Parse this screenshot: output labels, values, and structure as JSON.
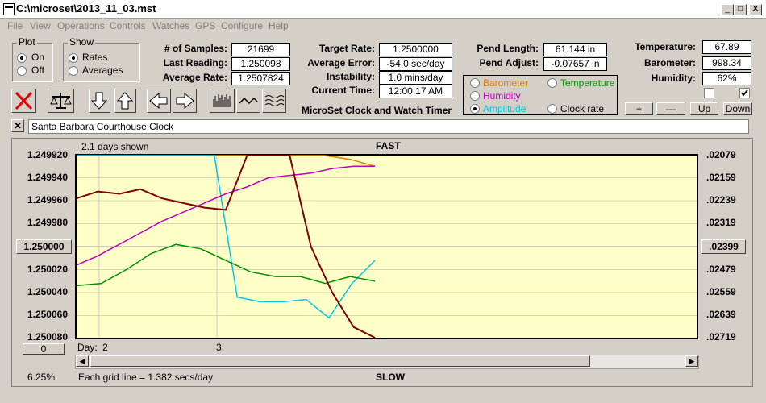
{
  "window": {
    "title": "C:\\microset\\2013_11_03.mst",
    "min": "_",
    "max": "□",
    "close": "X"
  },
  "menu": [
    "File",
    "View",
    "Operations",
    "Controls",
    "Watches",
    "GPS",
    "Configure",
    "Help"
  ],
  "plot": {
    "label": "Plot",
    "options": [
      "On",
      "Off"
    ],
    "selected": "On"
  },
  "show": {
    "label": "Show",
    "options": [
      "Rates",
      "Averages"
    ],
    "selected": "Rates"
  },
  "stats": {
    "samples_label": "# of Samples:",
    "samples": "21699",
    "last_label": "Last Reading:",
    "last": "1.250098",
    "avg_label": "Average Rate:",
    "avg": "1.2507824",
    "target_label": "Target Rate:",
    "target": "1.2500000",
    "error_label": "Average Error:",
    "error": "-54.0 sec/day",
    "instab_label": "Instability:",
    "instab": "1.0 mins/day",
    "time_label": "Current Time:",
    "time": "12:00:17 AM",
    "app_name": "MicroSet Clock and Watch Timer",
    "pend_len_label": "Pend Length:",
    "pend_len": "61.144 in",
    "pend_adj_label": "Pend Adjust:",
    "pend_adj": "-0.07657 in",
    "temp_label": "Temperature:",
    "temp": "67.89",
    "baro_label": "Barometer:",
    "baro": "998.34",
    "hum_label": "Humidity:",
    "hum": "62%"
  },
  "sensor_options": [
    {
      "label": "Barometer",
      "color": "#e08000"
    },
    {
      "label": "Temperature",
      "color": "#009000"
    },
    {
      "label": "Humidity",
      "color": "#c000c0"
    },
    {
      "label": "Amplitude",
      "color": "#00c8e0"
    },
    {
      "label": "Clock rate",
      "color": "#000000"
    }
  ],
  "sensor_selected": "Amplitude",
  "adjust_buttons": {
    "plus": "+",
    "minus": "—",
    "up": "Up",
    "down": "Down"
  },
  "clock_name": "Santa Barbara Courthouse Clock",
  "chart": {
    "days_shown": "2.1 days shown",
    "top": "FAST",
    "bottom": "SLOW",
    "grid_note": "Each grid line = 1.382 secs/day",
    "percent": "6.25%",
    "center_left": "1.250000",
    "center_right": ".02399",
    "zero_button": "0",
    "day_label": "Day:",
    "day_ticks": [
      "2",
      "3"
    ]
  },
  "chart_data": {
    "type": "line",
    "left_axis": [
      "1.249920",
      "1.249940",
      "1.249960",
      "1.249980",
      "1.250000",
      "1.250020",
      "1.250040",
      "1.250060",
      "1.250080"
    ],
    "right_axis": [
      ".02079",
      ".02159",
      ".02239",
      ".02319",
      ".02399",
      ".02479",
      ".02559",
      ".02639",
      ".02719"
    ],
    "series": [
      {
        "color": "#e08000",
        "values": [
          -6.5,
          -6.3,
          -6.0,
          -5.5,
          -5.2,
          -4.8,
          -4.9,
          -4.7,
          -4.8,
          -4.5,
          -4.3,
          -3.8,
          -3.5
        ]
      },
      {
        "color": "#00c8e0",
        "values": [
          -5.0,
          -5.0,
          -4.9,
          -4.8,
          -4.8,
          -4.7,
          -4.6,
          2.2,
          2.4,
          2.4,
          2.3,
          3.1,
          1.6,
          0.6
        ]
      },
      {
        "color": "#c000c0",
        "values": [
          0.8,
          0.4,
          -0.1,
          -0.6,
          -1.1,
          -1.5,
          -1.9,
          -2.3,
          -2.6,
          -3.0,
          -3.1,
          -3.2,
          -3.4,
          -3.5,
          -3.5
        ]
      },
      {
        "color": "#009000",
        "values": [
          1.7,
          1.6,
          1.0,
          0.3,
          -0.1,
          0.1,
          0.6,
          1.1,
          1.3,
          1.3,
          1.6,
          1.3,
          1.5
        ]
      },
      {
        "color": "#800000",
        "values": [
          -2.1,
          -2.4,
          -2.3,
          -2.5,
          -2.1,
          -1.9,
          -1.7,
          -1.6,
          -6.0,
          -11.0,
          -15.0,
          0.0,
          2.0,
          3.5,
          6.0
        ]
      }
    ]
  }
}
